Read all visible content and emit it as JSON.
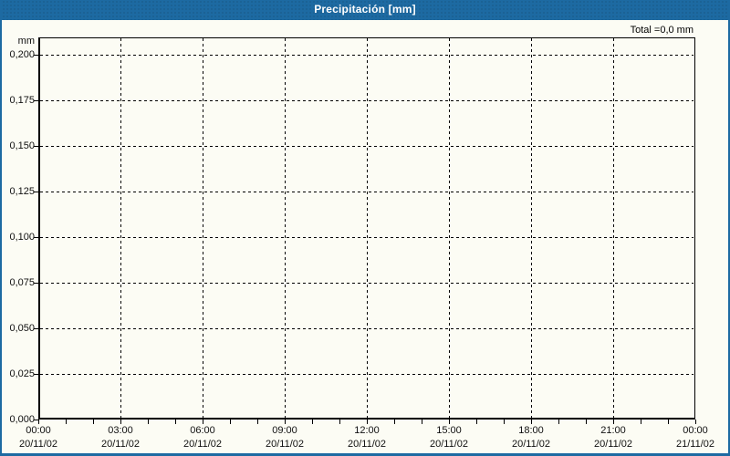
{
  "window": {
    "title": "Precipitación [mm]"
  },
  "summary": {
    "total_label": "Total =0,0 mm"
  },
  "axes": {
    "y_unit": "mm",
    "y_tick_labels": [
      "0,200",
      "0,175",
      "0,150",
      "0,125",
      "0,100",
      "0,075",
      "0,050",
      "0,025",
      "0,000"
    ],
    "x_ticks": [
      {
        "time": "00:00",
        "date": "20/11/02"
      },
      {
        "time": "03:00",
        "date": "20/11/02"
      },
      {
        "time": "06:00",
        "date": "20/11/02"
      },
      {
        "time": "09:00",
        "date": "20/11/02"
      },
      {
        "time": "12:00",
        "date": "20/11/02"
      },
      {
        "time": "15:00",
        "date": "20/11/02"
      },
      {
        "time": "18:00",
        "date": "20/11/02"
      },
      {
        "time": "21:00",
        "date": "20/11/02"
      },
      {
        "time": "00:00",
        "date": "21/11/02"
      }
    ]
  },
  "colors": {
    "titlebar": "#1d6aa2",
    "background": "#fcfcf4",
    "grid": "#000000",
    "axis": "#000000",
    "title_text": "#ffffff",
    "label_text": "#000000"
  },
  "chart_data": {
    "type": "line",
    "title": "Precipitación [mm]",
    "xlabel": "",
    "ylabel": "mm",
    "ylim": [
      0,
      0.21
    ],
    "yticks": [
      0.0,
      0.025,
      0.05,
      0.075,
      0.1,
      0.125,
      0.15,
      0.175,
      0.2
    ],
    "ytick_labels_locale": "decimal-comma",
    "x_range": [
      "20/11/02 00:00",
      "21/11/02 00:00"
    ],
    "xtick_interval_hours": 3,
    "minor_xtick_interval_hours": 1,
    "grid": "dashed",
    "legend_position": "none",
    "series": [
      {
        "name": "Precipitación [mm]",
        "values": []
      }
    ],
    "total_mm": 0.0,
    "annotations": [
      "Total =0,0 mm"
    ]
  }
}
